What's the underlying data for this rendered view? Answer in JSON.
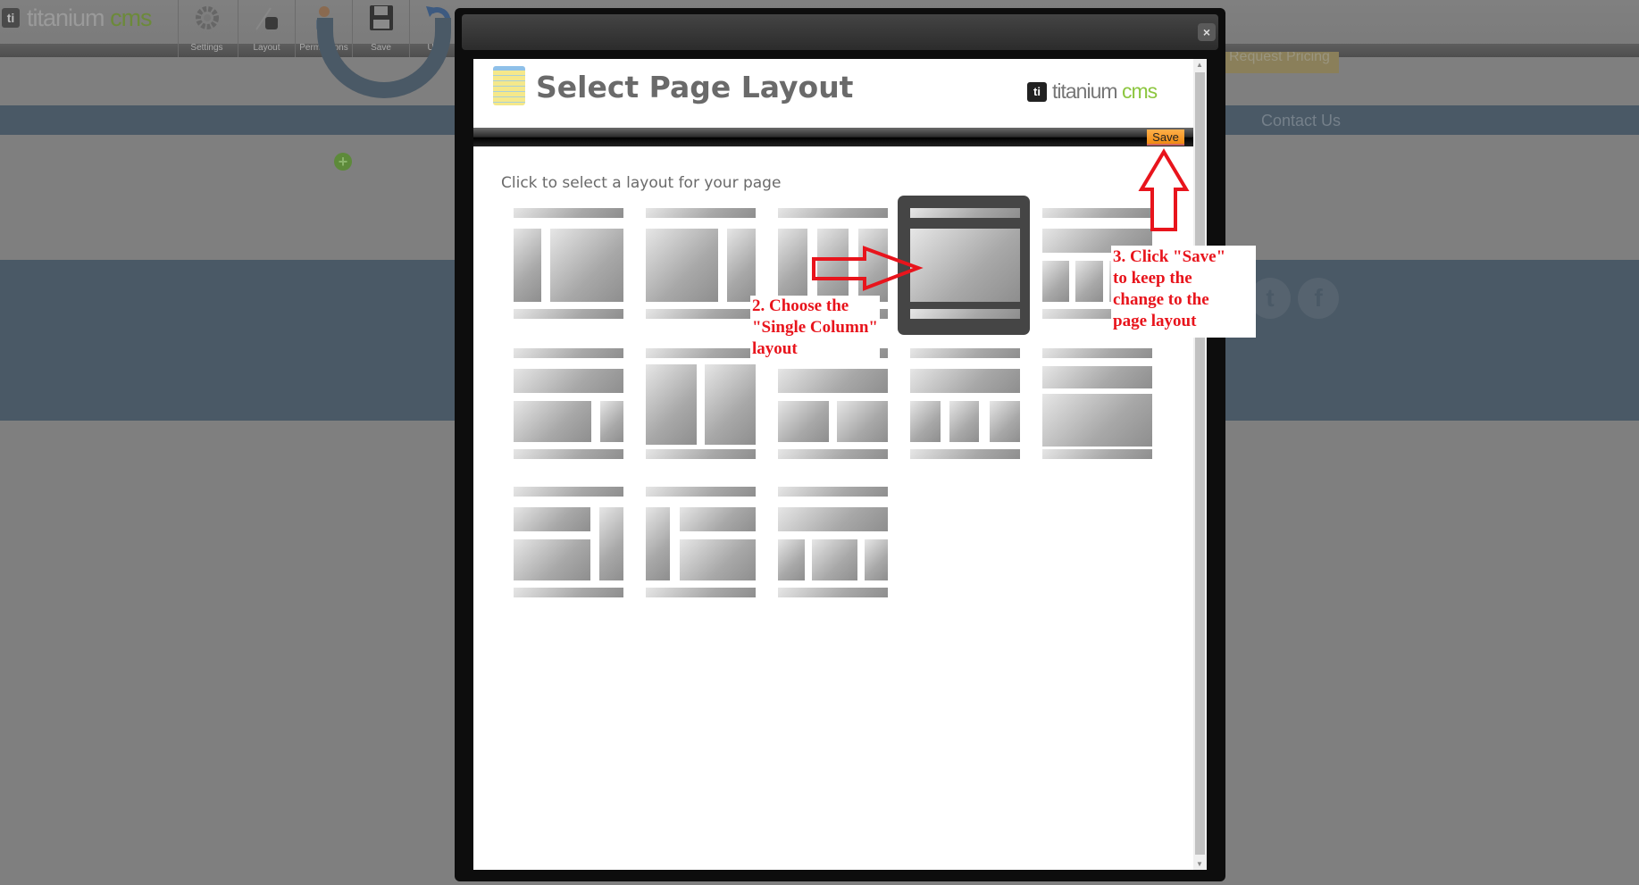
{
  "app": {
    "logo_text": "titanium",
    "logo_accent": "cms",
    "logo_mark": "ti"
  },
  "toolbar": {
    "items": [
      {
        "label": "Settings",
        "icon": "gear-icon"
      },
      {
        "label": "Layout",
        "icon": "pen-ink-icon"
      },
      {
        "label": "Permissions",
        "icon": "user-icon"
      },
      {
        "label": "Save",
        "icon": "floppy-disk-icon"
      },
      {
        "label": "Undo",
        "icon": "undo-icon"
      }
    ]
  },
  "site": {
    "nav_contact": "Contact Us",
    "request_pricing": "Request Pricing",
    "social": [
      "twitter",
      "facebook"
    ]
  },
  "modal": {
    "title": "Select Page Layout",
    "logo_text": "titanium",
    "logo_accent": "cms",
    "logo_mark": "ti",
    "save_label": "Save",
    "instruction": "Click to select a layout for your page",
    "close_icon": "×",
    "layouts": {
      "selected_index": 3,
      "selected_name": "Single Column"
    }
  },
  "annotations": {
    "step2": [
      "2. Choose the",
      "\"Single Column\"",
      "layout"
    ],
    "step3": [
      "3. Click \"Save\"",
      "to keep the",
      "change to the",
      "page layout"
    ],
    "color": "#e8141c"
  },
  "colors": {
    "accent": "#8cc63f",
    "save": "#f5981f",
    "band": "#4a5966"
  }
}
